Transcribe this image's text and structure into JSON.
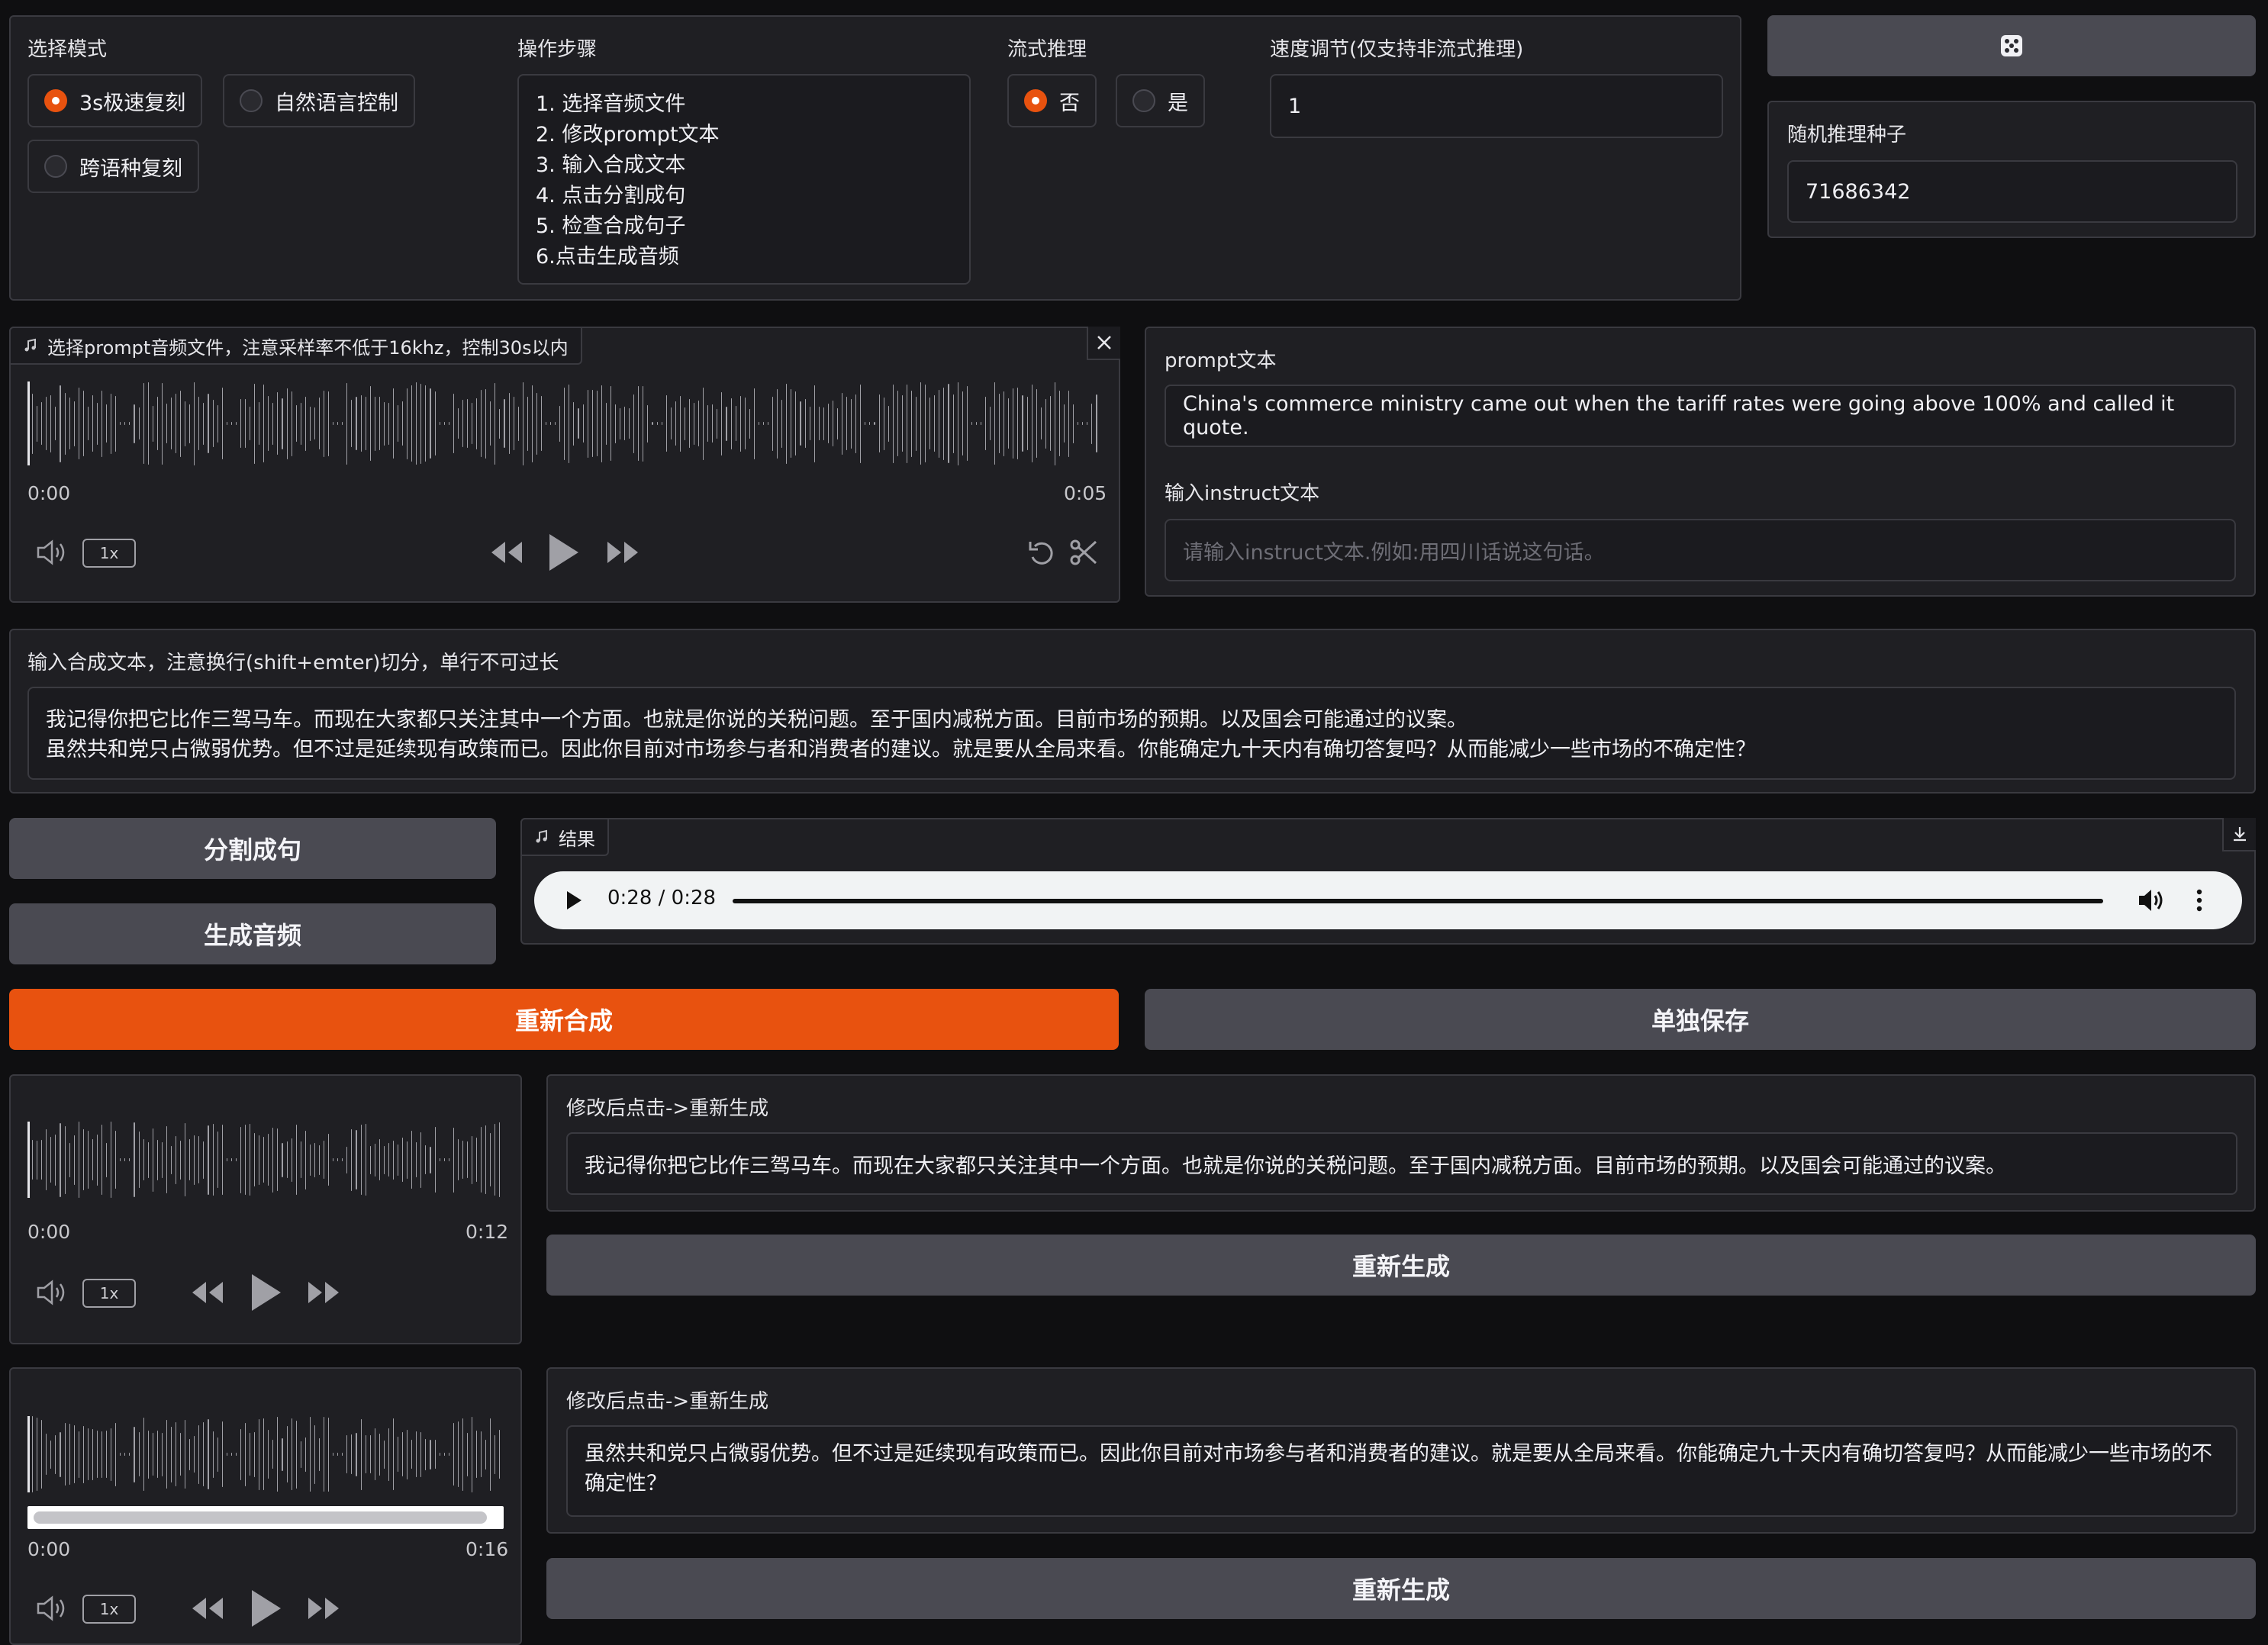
{
  "mode": {
    "label": "选择模式",
    "options": [
      {
        "label": "3s极速复刻",
        "selected": true
      },
      {
        "label": "自然语言控制",
        "selected": false
      },
      {
        "label": "跨语种复刻",
        "selected": false
      }
    ]
  },
  "steps": {
    "label": "操作步骤",
    "items": [
      "1. 选择音频文件",
      "2. 修改prompt文本",
      "3. 输入合成文本",
      "4. 点击分割成句",
      "5. 检查合成句子",
      "6.点击生成音频"
    ]
  },
  "stream": {
    "label": "流式推理",
    "options": [
      {
        "label": "否",
        "selected": true
      },
      {
        "label": "是",
        "selected": false
      }
    ]
  },
  "speed": {
    "label": "速度调节(仅支持非流式推理)",
    "value": "1"
  },
  "seed": {
    "label": "随机推理种子",
    "value": "71686342"
  },
  "prompt_audio": {
    "label": "选择prompt音频文件，注意采样率不低于16khz，控制30s以内",
    "start": "0:00",
    "end": "0:05",
    "rate": "1x"
  },
  "prompt_text": {
    "label": "prompt文本",
    "value": "China's commerce ministry came out when the tariff rates were going above 100% and called it quote."
  },
  "instruct": {
    "label": "输入instruct文本",
    "placeholder": "请输入instruct文本.例如:用四川话说这句话。"
  },
  "synth": {
    "label": "输入合成文本，注意换行(shift+emter)切分，单行不可过长",
    "line1": "我记得你把它比作三驾马车。而现在大家都只关注其中一个方面。也就是你说的关税问题。至于国内减税方面。目前市场的预期。以及国会可能通过的议案。",
    "line2": "虽然共和党只占微弱优势。但不过是延续现有政策而已。因此你目前对市场参与者和消费者的建议。就是要从全局来看。你能确定九十天内有确切答复吗？从而能减少一些市场的不确定性？"
  },
  "buttons": {
    "split": "分割成句",
    "generate": "生成音频",
    "resynth": "重新合成",
    "save": "单独保存"
  },
  "result": {
    "label": "结果",
    "time": "0:28 / 0:28",
    "progress": 1.0
  },
  "segments": [
    {
      "label": "修改后点击->重新生成",
      "text": "我记得你把它比作三驾马车。而现在大家都只关注其中一个方面。也就是你说的关税问题。至于国内减税方面。目前市场的预期。以及国会可能通过的议案。",
      "button": "重新生成",
      "start": "0:00",
      "end": "0:12",
      "rate": "1x"
    },
    {
      "label": "修改后点击->重新生成",
      "text": "虽然共和党只占微弱优势。但不过是延续现有政策而已。因此你目前对市场参与者和消费者的建议。就是要从全局来看。你能确定九十天内有确切答复吗？从而能减少一些市场的不确定性？",
      "button": "重新生成",
      "start": "0:00",
      "end": "0:16",
      "rate": "1x"
    }
  ],
  "colors": {
    "accent": "#e8520f",
    "button": "#4a4a52",
    "panel": "#1f1f23",
    "background": "#0f0f11"
  }
}
